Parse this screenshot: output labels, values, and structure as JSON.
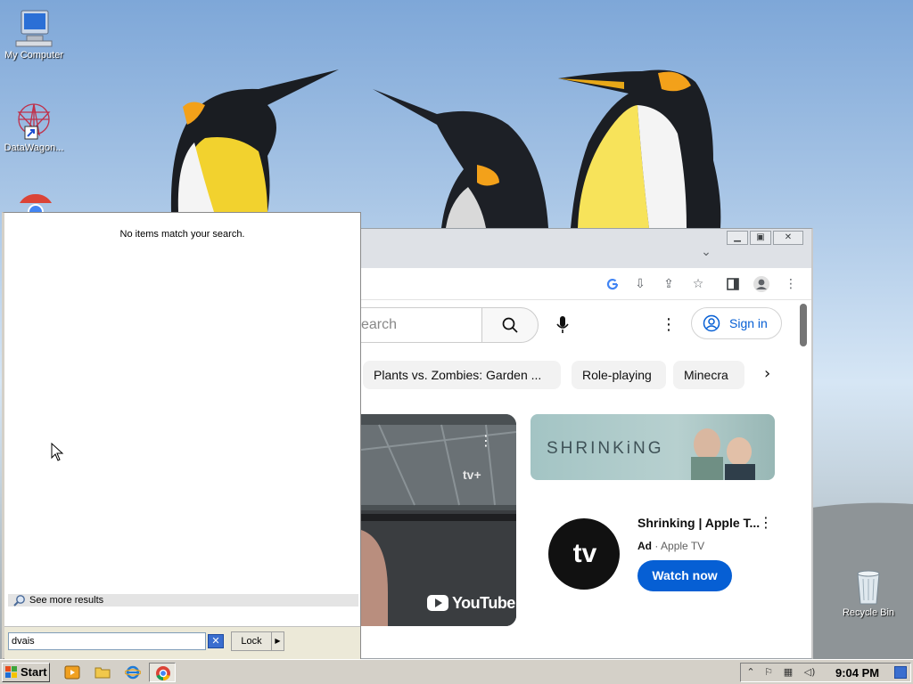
{
  "desktop": {
    "icons": [
      {
        "label": "My Computer"
      },
      {
        "label": "DataWagon..."
      },
      {
        "label": "Recycle Bin"
      }
    ]
  },
  "search_panel": {
    "empty_message": "No items match your search.",
    "see_more_label": "See more results",
    "query": "dvais",
    "lock_label": "Lock"
  },
  "browser": {
    "search_placeholder_fragment": "earch",
    "sign_in_label": "Sign in",
    "chips": [
      "Plants vs. Zombies: Garden ...",
      "Role-playing",
      "Minecra"
    ],
    "thumbnail": {
      "channel_mark": "tv+",
      "brand": "YouTube"
    },
    "ad": {
      "banner_word": "SHRINKiNG",
      "logo_text": "tv",
      "title": "Shrinking | Apple T...",
      "ad_label": "Ad",
      "advertiser": "Apple TV",
      "cta_label": "Watch now"
    }
  },
  "taskbar": {
    "start_label": "Start",
    "clock": "9:04 PM"
  },
  "colors": {
    "youtube_blue": "#065fd4",
    "taskbar_gray": "#d4d0c8",
    "chrome_frame": "#dee1e6"
  }
}
